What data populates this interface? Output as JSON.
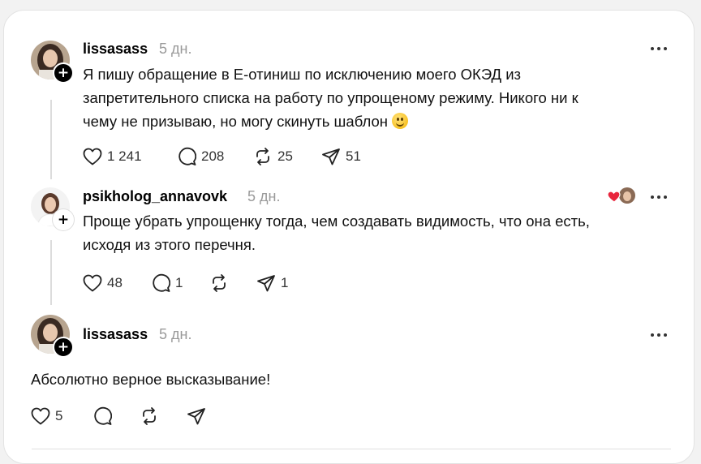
{
  "posts": [
    {
      "username": "lissasass",
      "time": "5 дн.",
      "text_lines": [
        "Я пишу обращение в Е-отиниш по исключению моего ОКЭД из",
        "запретительного списка на работу по упрощеному режиму. Никого ни к",
        "чему не призываю, но могу скинуть шаблон"
      ],
      "emoji": "slightly-smiling-face",
      "likes": "1 241",
      "comments": "208",
      "reposts": "25",
      "shares": "51"
    },
    {
      "username": "psikholog_annavovk",
      "time": "5 дн.",
      "text_lines": [
        "Проще убрать упрощенку тогда, чем создавать видимость, что она есть,",
        "исходя из этого перечня."
      ],
      "likes": "48",
      "comments": "1",
      "reposts": "",
      "shares": "1"
    },
    {
      "username": "lissasass",
      "time": "5 дн.",
      "text_lines": [
        "Абсолютно верное высказывание!"
      ],
      "likes": "5",
      "comments": "",
      "reposts": "",
      "shares": ""
    }
  ],
  "icons": {
    "like": "heart-icon",
    "comment": "comment-bubble-icon",
    "repost": "repost-icon",
    "share": "send-icon",
    "more": "more-options-icon",
    "follow": "plus-icon",
    "liked_by_author": "red-heart-icon"
  },
  "colors": {
    "background": "#ffffff",
    "secondary_text": "#9a9a9a",
    "liked_heart": "#e8263d",
    "thread_line": "#dcdcdc"
  }
}
